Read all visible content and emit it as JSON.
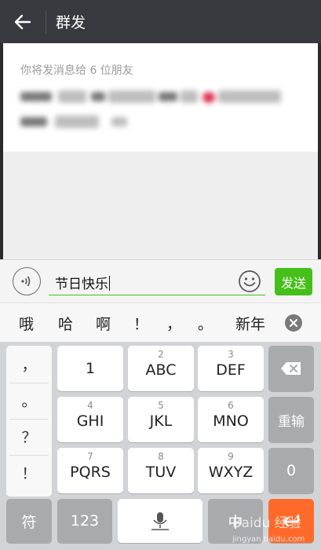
{
  "header": {
    "title": "群发"
  },
  "recipients": {
    "label": "你将发消息给 6 位朋友"
  },
  "input_bar": {
    "text": "节日快乐",
    "send_label": "发送"
  },
  "candidates": [
    "哦",
    "哈",
    "啊",
    "！",
    "，",
    "。",
    "新年"
  ],
  "keyboard": {
    "punctuation": [
      "，",
      "。",
      "？",
      "！"
    ],
    "keys": [
      {
        "num": "",
        "main": "1"
      },
      {
        "num": "2",
        "main": "ABC"
      },
      {
        "num": "3",
        "main": "DEF"
      },
      {
        "num": "4",
        "main": "GHI"
      },
      {
        "num": "5",
        "main": "JKL"
      },
      {
        "num": "6",
        "main": "MNO"
      },
      {
        "num": "7",
        "main": "PQRS"
      },
      {
        "num": "8",
        "main": "TUV"
      },
      {
        "num": "9",
        "main": "WXYZ"
      }
    ],
    "reenter_label": "重输",
    "zero_label": "0",
    "symbol_label": "符",
    "numeric_label": "123",
    "lang_label": "中"
  },
  "watermark": {
    "brand": "Baidu 经验",
    "url": "jingyan.baidu.com"
  },
  "colors": {
    "accent_green": "#45c01a",
    "header_bg": "#393a3f",
    "enter_key": "#ff6a2b"
  }
}
